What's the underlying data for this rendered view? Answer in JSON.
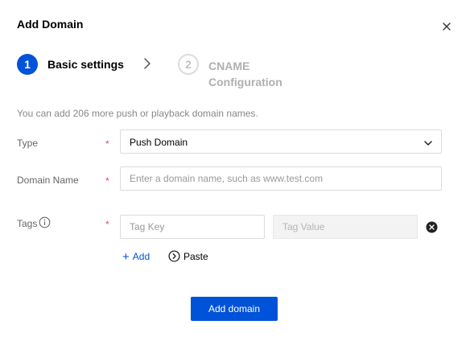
{
  "dialog": {
    "title": "Add Domain",
    "close_icon": "close-icon"
  },
  "stepper": {
    "steps": [
      {
        "number": "1",
        "label": "Basic settings",
        "active": true
      },
      {
        "number": "2",
        "label": "CNAME Configuration",
        "active": false
      }
    ],
    "separator_icon": "chevron-right-icon"
  },
  "info_text": "You can add 206 more push or playback domain names.",
  "form": {
    "required_mark": "*",
    "type": {
      "label": "Type",
      "value": "Push Domain",
      "icon": "chevron-down-icon"
    },
    "domain_name": {
      "label": "Domain Name",
      "value": "",
      "placeholder": "Enter a domain name, such as www.test.com"
    },
    "tags": {
      "label": "Tags",
      "help_icon": "info-circle-icon",
      "key_placeholder": "Tag Key",
      "value_placeholder": "Tag Value",
      "remove_icon": "close-circle-icon",
      "add_label": "Add",
      "paste_label": "Paste",
      "paste_icon": "chevron-right-circle-icon"
    }
  },
  "footer": {
    "submit_label": "Add domain"
  },
  "colors": {
    "primary": "#0052d9",
    "required": "#e34d59",
    "muted_text": "#888888",
    "border": "#dcdcdc"
  }
}
